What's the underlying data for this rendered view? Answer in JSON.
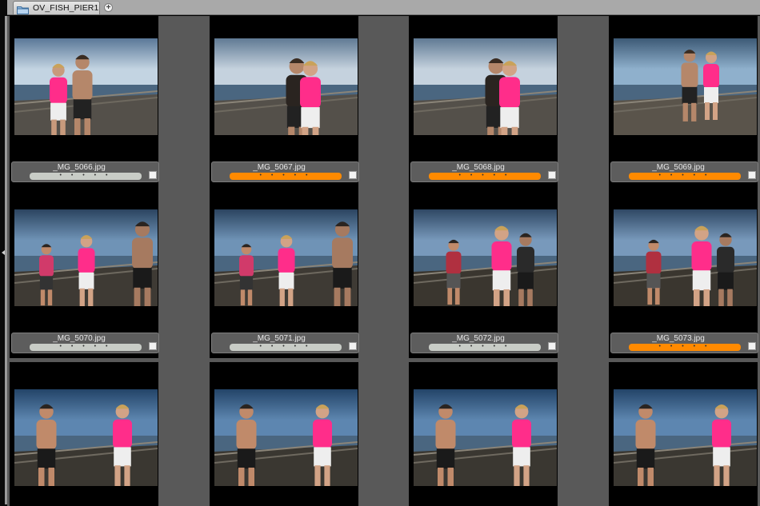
{
  "tab": {
    "label": "OV_FISH_PIER1",
    "add_label": "+"
  },
  "label_colors": {
    "none": "#c8ccc6",
    "orange": "#ff8a00"
  },
  "thumbnails": [
    {
      "filename": "_MG_5066.jpg",
      "label": "none",
      "rating_dots": "• • • • •",
      "scene": "couple-sunset"
    },
    {
      "filename": "_MG_5067.jpg",
      "label": "orange",
      "rating_dots": "• • • • •",
      "scene": "couple-hug"
    },
    {
      "filename": "_MG_5068.jpg",
      "label": "orange",
      "rating_dots": "• • • • •",
      "scene": "couple-hug"
    },
    {
      "filename": "_MG_5069.jpg",
      "label": "orange",
      "rating_dots": "• • • • •",
      "scene": "couple-pier-wide"
    },
    {
      "filename": "_MG_5070.jpg",
      "label": "none",
      "rating_dots": "• • • • •",
      "scene": "pier-group"
    },
    {
      "filename": "_MG_5071.jpg",
      "label": "none",
      "rating_dots": "• • • • •",
      "scene": "pier-talk"
    },
    {
      "filename": "_MG_5072.jpg",
      "label": "none",
      "rating_dots": "• • • • •",
      "scene": "pier-laugh"
    },
    {
      "filename": "_MG_5073.jpg",
      "label": "orange",
      "rating_dots": "• • • • •",
      "scene": "pier-laugh-2"
    },
    {
      "filename": "",
      "label": "none",
      "rating_dots": "",
      "scene": "hands-1"
    },
    {
      "filename": "",
      "label": "none",
      "rating_dots": "",
      "scene": "hands-2"
    },
    {
      "filename": "",
      "label": "none",
      "rating_dots": "",
      "scene": "hands-3"
    },
    {
      "filename": "",
      "label": "none",
      "rating_dots": "",
      "scene": "hands-4"
    }
  ]
}
